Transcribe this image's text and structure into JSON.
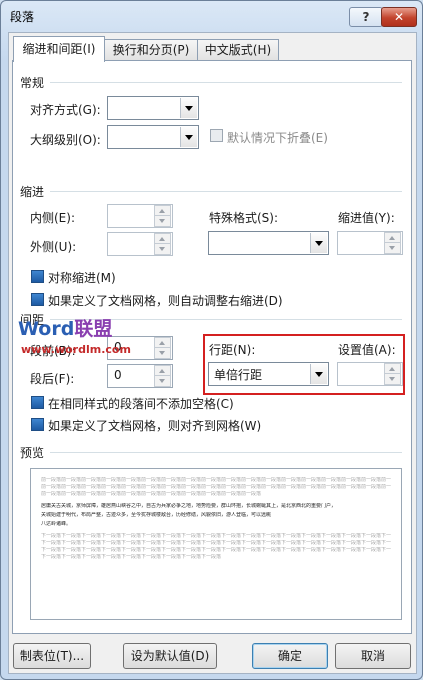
{
  "window": {
    "title": "段落",
    "help": "?",
    "close": "✕"
  },
  "tabs": [
    {
      "label": "缩进和间距(I)"
    },
    {
      "label": "换行和分页(P)"
    },
    {
      "label": "中文版式(H)"
    }
  ],
  "general": {
    "section": "常规",
    "align_label": "对齐方式(G):",
    "align_value": "",
    "outline_label": "大纲级别(O):",
    "outline_value": "",
    "collapse_label": "默认情况下折叠(E)"
  },
  "indent": {
    "section": "缩进",
    "inside_label": "内侧(E):",
    "inside_value": "",
    "outside_label": "外侧(U):",
    "outside_value": "",
    "special_label": "特殊格式(S):",
    "special_value": "",
    "by_label": "缩进值(Y):",
    "by_value": "",
    "mirror_label": "对称缩进(M)",
    "grid_label": "如果定义了文档网格，则自动调整右缩进(D)"
  },
  "spacing": {
    "section": "间距",
    "before_label": "段前(B):",
    "before_value": "0",
    "after_label": "段后(F):",
    "after_value": "0",
    "line_label": "行距(N):",
    "line_value": "单倍行距",
    "at_label": "设置值(A):",
    "at_value": "",
    "no_space_label": "在相同样式的段落间不添加空格(C)",
    "snap_label": "如果定义了文档网格，则对齐到网格(W)"
  },
  "preview": {
    "section": "预览",
    "prev_text": "前一段落前一段落前一段落前一段落前一段落前一段落前一段落前一段落前一段落前一段落前一段落前一段落前一段落前一段落前一段落前一段落前一段落前一段落前一段落",
    "body_text_1": "居庸关古关城，京师屏障，雄居燕山峡谷之中，自古为兵家必争之地，地势险要，群山环抱，长城蜿蜒其上，是北京西北的重要门户，",
    "body_text_2": "关城始建于明代，布局严整，古迹众多，至今犹存城楼敌台，历经修缮，风貌依旧，游人登临，可以远眺",
    "body_text_3": "八达岭诸峰。",
    "next_text": "下一段落下一段落下一段落下一段落下一段落下一段落下一段落下一段落下一段落下一段落下一段落下一段落下一段落下一段落下一段落下一段落下一段落下一段落下一段落下一段落下一段落下一段落"
  },
  "watermark": {
    "brand_a": "Word",
    "brand_b": "联盟",
    "url": "www.wordlm.com"
  },
  "buttons": {
    "tabs": "制表位(T)...",
    "set_default": "设为默认值(D)",
    "ok": "确定",
    "cancel": "取消"
  },
  "colors": {
    "highlight_border": "#d42020",
    "checkbox_checked": "#2a6bbb",
    "watermark_blue": "#2b5fb3",
    "watermark_purple": "#8a3fb0"
  }
}
